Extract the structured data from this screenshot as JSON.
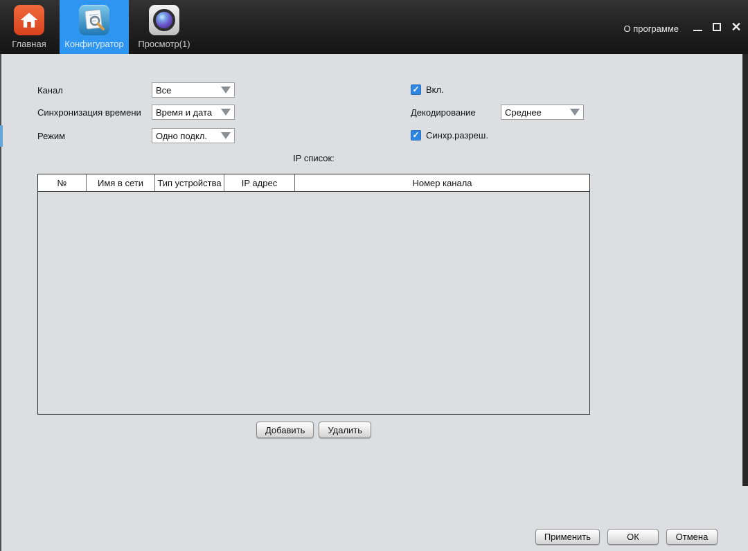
{
  "window": {
    "about_label": "О программе"
  },
  "tabs": [
    {
      "label": "Главная",
      "icon": "home-icon",
      "active": false
    },
    {
      "label": "Конфигуратор",
      "icon": "configurator-icon",
      "active": true
    },
    {
      "label": "Просмотр(1)",
      "icon": "preview-icon",
      "active": false
    }
  ],
  "form": {
    "channel": {
      "label": "Канал",
      "value": "Все"
    },
    "time_sync": {
      "label": "Синхронизация времени",
      "value": "Время и дата"
    },
    "mode": {
      "label": "Режим",
      "value": "Одно подкл."
    },
    "enable": {
      "label": "Вкл.",
      "checked": true
    },
    "decoding": {
      "label": "Декодирование",
      "value": "Среднее"
    },
    "sync_resolution": {
      "label": "Синхр.разреш.",
      "checked": true
    }
  },
  "ip_list": {
    "title": "IP список:",
    "columns": [
      "№",
      "Имя в сети",
      "Тип устройства",
      "IP адрес",
      "Номер канала"
    ],
    "rows": []
  },
  "buttons": {
    "add": "Добавить",
    "delete": "Удалить",
    "apply": "Применить",
    "ok": "ОК",
    "cancel": "Отмена"
  },
  "colors": {
    "topbar_dark": "#232323",
    "active_tab_blue": "#2e96f0",
    "home_icon_orange": "#e4532a",
    "checkbox_blue": "#2f86e0",
    "content_background": "#dcdee2",
    "handle_blue": "#63a7dc"
  }
}
